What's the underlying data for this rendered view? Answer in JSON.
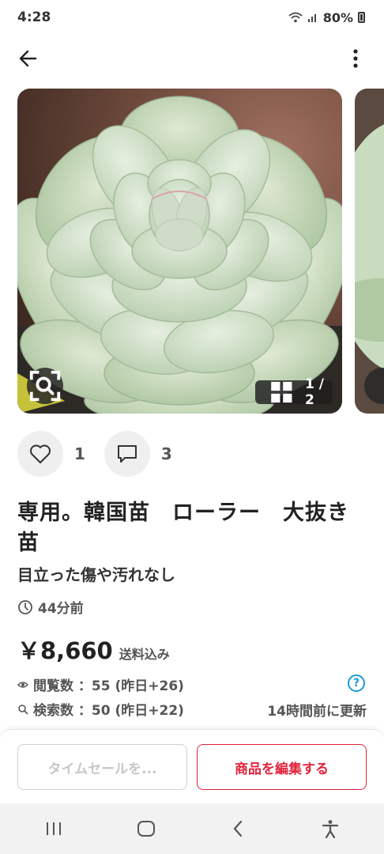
{
  "status_bar": {
    "time": "4:28",
    "battery": "80%"
  },
  "header": {
    "back_icon": "arrow-left-icon",
    "more_icon": "more-vertical-icon"
  },
  "gallery": {
    "page_counter": "1 / 2",
    "lens_icon": "image-search-icon"
  },
  "actions": {
    "like_count": "1",
    "comment_count": "3"
  },
  "item": {
    "title": "専用。韓国苗　ローラー　大抜き苗",
    "condition": "目立った傷や汚れなし",
    "posted": "44分前",
    "price": "￥8,660",
    "shipping": "送料込み"
  },
  "stats": {
    "views_label": "閲覧数 ：55 (昨日+26)",
    "search_label": "検索数 ：50 (昨日+22)",
    "updated": "14時間前に更新",
    "help": "?"
  },
  "buttons": {
    "time_sale": "タイムセールを...",
    "edit": "商品を編集する"
  },
  "colors": {
    "accent": "#e0243c",
    "help": "#1a9bd7"
  }
}
